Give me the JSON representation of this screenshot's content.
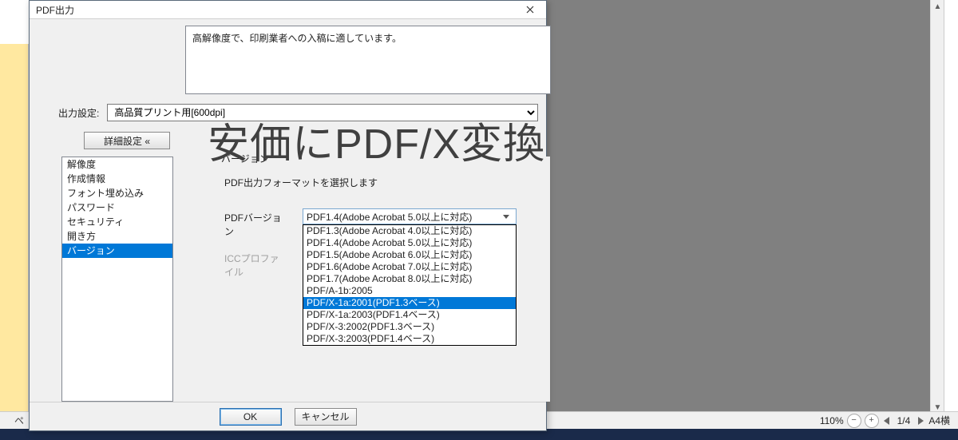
{
  "overlay_title": "安価にPDF/X変換",
  "dialog": {
    "title": "PDF出力",
    "description": "高解像度で、印刷業者への入稿に適しています。",
    "output_label": "出力設定:",
    "output_value": "高品質プリント用[600dpi]",
    "detail_button": "詳細設定 «",
    "ok": "OK",
    "cancel": "キャンセル"
  },
  "sidebar": {
    "items": [
      "解像度",
      "作成情報",
      "フォント埋め込み",
      "パスワード",
      "セキュリティ",
      "開き方",
      "バージョン"
    ],
    "selected_index": 6
  },
  "panel": {
    "legend": "バージョン",
    "subtitle": "PDF出力フォーマットを選択します",
    "pdf_version_label": "PDFバージョン",
    "icc_profile_label": "ICCプロファイル",
    "pdf_version_selected": "PDF1.4(Adobe Acrobat 5.0以上に対応)",
    "dropdown": [
      "PDF1.3(Adobe Acrobat 4.0以上に対応)",
      "PDF1.4(Adobe Acrobat 5.0以上に対応)",
      "PDF1.5(Adobe Acrobat 6.0以上に対応)",
      "PDF1.6(Adobe Acrobat 7.0以上に対応)",
      "PDF1.7(Adobe Acrobat 8.0以上に対応)",
      "PDF/A-1b:2005",
      "PDF/X-1a:2001(PDF1.3ベース)",
      "PDF/X-1a:2003(PDF1.4ベース)",
      "PDF/X-3:2002(PDF1.3ベース)",
      "PDF/X-3:2003(PDF1.4ベース)"
    ],
    "dropdown_selected_index": 6
  },
  "statusbar": {
    "left_prefix": "ペ",
    "zoom": "110%",
    "page": "1/4",
    "paper": "A4横"
  }
}
